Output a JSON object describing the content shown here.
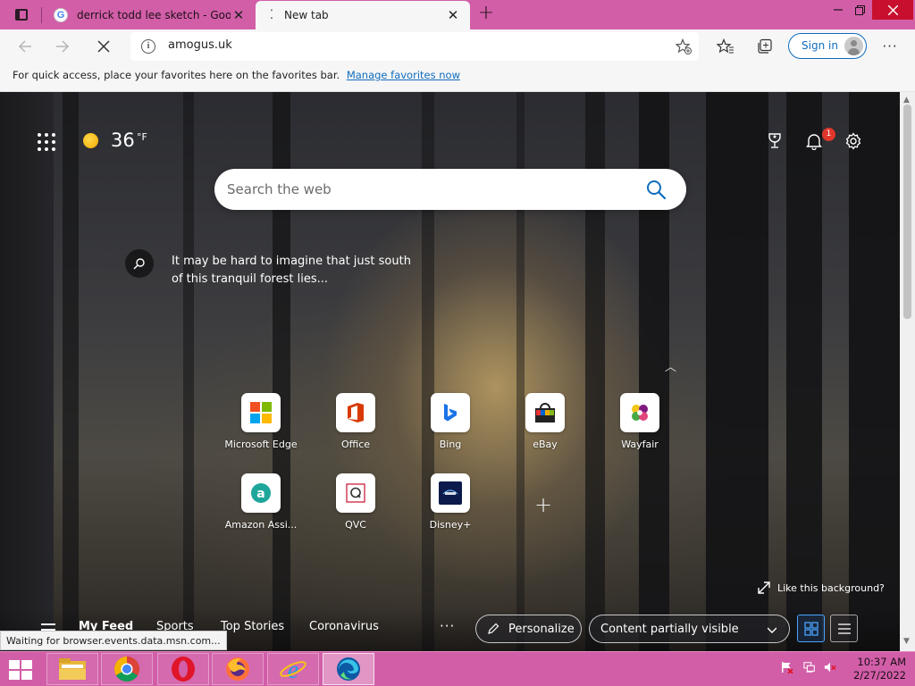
{
  "browser": {
    "tabs": [
      {
        "title": "derrick todd lee sketch - Google",
        "icon": "google-icon"
      },
      {
        "title": "New tab",
        "icon": "loading-spinner-icon"
      }
    ],
    "address": {
      "url": "amogus.uk"
    },
    "sign_in_label": "Sign in",
    "favorites_bar": {
      "text": "For quick access, place your favorites here on the favorites bar.",
      "link": "Manage favorites now"
    },
    "status_text": "Waiting for browser.events.data.msn.com..."
  },
  "newtab": {
    "weather": {
      "temp": "36",
      "unit": "°F"
    },
    "notification_count": "1",
    "search": {
      "placeholder": "Search the web"
    },
    "story_text": "It may be hard to imagine that just south of this tranquil forest lies...",
    "quick_links": [
      {
        "label": "Microsoft Edge",
        "icon": "microsoft-logo-icon"
      },
      {
        "label": "Office",
        "icon": "office-logo-icon"
      },
      {
        "label": "Bing",
        "icon": "bing-logo-icon"
      },
      {
        "label": "eBay",
        "icon": "ebay-bag-icon"
      },
      {
        "label": "Wayfair",
        "icon": "wayfair-logo-icon"
      },
      {
        "label": "Amazon Assi...",
        "icon": "amazon-assistant-icon"
      },
      {
        "label": "QVC",
        "icon": "qvc-logo-icon"
      },
      {
        "label": "Disney+",
        "icon": "disney-plus-icon"
      }
    ],
    "like_background": "Like this background?",
    "feed_tabs": [
      "My Feed",
      "Sports",
      "Top Stories",
      "Coronavirus"
    ],
    "personalize_label": "Personalize",
    "content_visibility": "Content partially visible"
  },
  "taskbar": {
    "apps": [
      "file-explorer-icon",
      "chrome-icon",
      "opera-icon",
      "firefox-icon",
      "internet-explorer-icon",
      "edge-icon"
    ],
    "time": "10:37 AM",
    "date": "2/27/2022"
  },
  "colors": {
    "tabstrip": "#d25ea8",
    "accent": "#0f6cbd",
    "close_button": "#c8102e"
  }
}
